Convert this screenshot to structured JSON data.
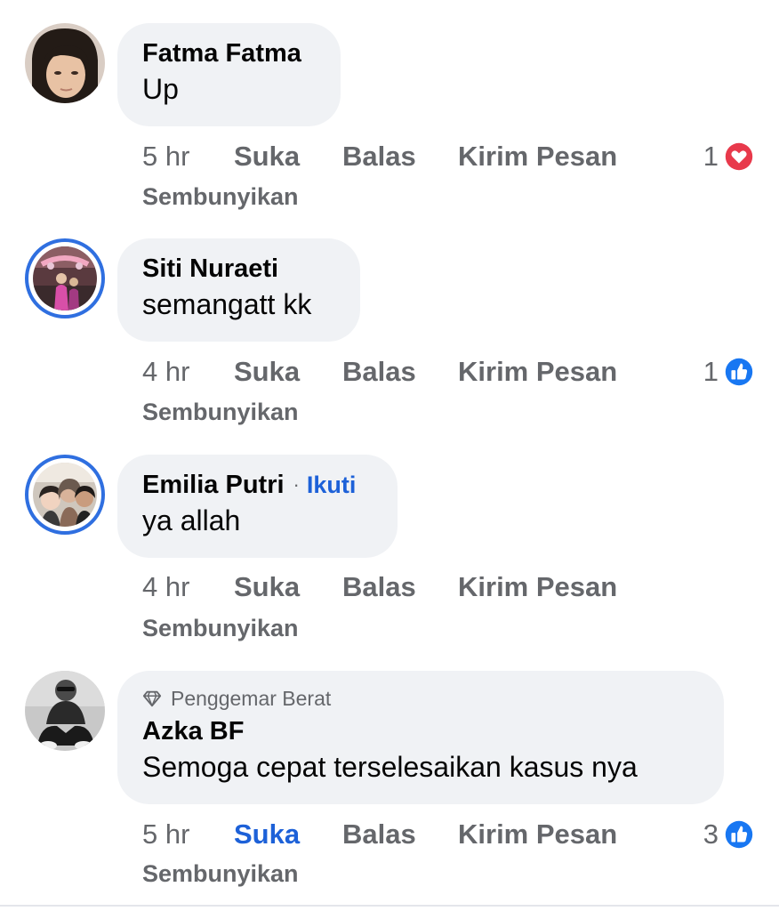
{
  "comments": [
    {
      "author": "Fatma Fatma",
      "text": "Up",
      "time": "5 hr",
      "like": "Suka",
      "reply": "Balas",
      "message": "Kirim Pesan",
      "hide": "Sembunyikan",
      "reaction_count": "1",
      "reaction_icon": "love-reaction-icon",
      "like_active": false
    },
    {
      "author": "Siti Nuraeti",
      "text": "semangatt kk",
      "time": "4 hr",
      "like": "Suka",
      "reply": "Balas",
      "message": "Kirim Pesan",
      "hide": "Sembunyikan",
      "reaction_count": "1",
      "reaction_icon": "like-reaction-icon",
      "like_active": false
    },
    {
      "author": "Emilia Putri",
      "follow": "Ikuti",
      "text": "ya allah",
      "time": "4 hr",
      "like": "Suka",
      "reply": "Balas",
      "message": "Kirim Pesan",
      "hide": "Sembunyikan",
      "like_active": false
    },
    {
      "badge": "Penggemar Berat",
      "author": "Azka BF",
      "text": "Semoga cepat terselesaikan kasus nya",
      "time": "5 hr",
      "like": "Suka",
      "reply": "Balas",
      "message": "Kirim Pesan",
      "hide": "Sembunyikan",
      "reaction_count": "3",
      "reaction_icon": "like-reaction-icon",
      "like_active": true
    }
  ],
  "colors": {
    "bubble": "#f0f2f5",
    "muted": "#65676b",
    "link_blue": "#1d61d8",
    "love_red": "#e8394b",
    "like_blue": "#1877f2"
  }
}
